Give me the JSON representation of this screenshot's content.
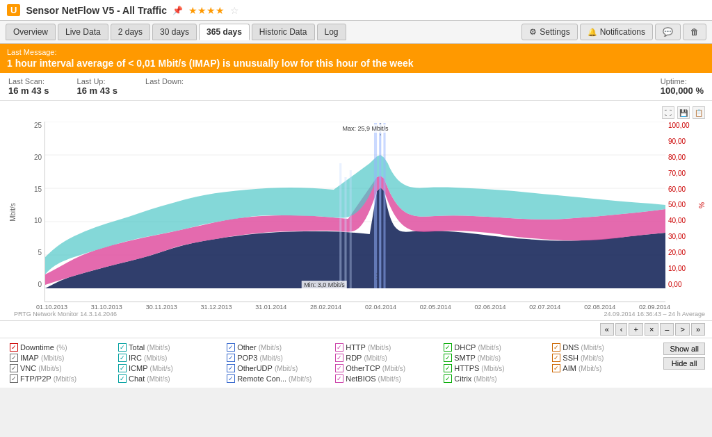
{
  "titleBar": {
    "badge": "U",
    "title": "Sensor NetFlow V5 - All Traffic",
    "stars": "★★★★",
    "halfStar": "☆"
  },
  "tabs": [
    {
      "label": "Overview",
      "active": false
    },
    {
      "label": "Live Data",
      "active": false
    },
    {
      "label": "2 days",
      "active": false
    },
    {
      "label": "30 days",
      "active": false
    },
    {
      "label": "365 days",
      "active": true
    },
    {
      "label": "Historic Data",
      "active": false
    },
    {
      "label": "Log",
      "active": false
    }
  ],
  "navButtons": [
    {
      "label": "Settings",
      "icon": "gear"
    },
    {
      "label": "Notifications",
      "icon": "bell"
    }
  ],
  "alert": {
    "label": "Last Message:",
    "message": "1 hour interval average of < 0,01 Mbit/s (IMAP) is unusually low for this hour of the week"
  },
  "stats": {
    "lastScan": {
      "label": "Last Scan:",
      "value": "16 m 43 s"
    },
    "lastUp": {
      "label": "Last Up:",
      "value": "16 m 43 s"
    },
    "lastDown": {
      "label": "Last Down:",
      "value": ""
    },
    "uptime": {
      "label": "Uptime:",
      "value": "100,000 %"
    }
  },
  "chart": {
    "yAxisLeft": [
      "25",
      "20",
      "15",
      "10",
      "5",
      "0"
    ],
    "yAxisLeftLabel": "Mbit/s",
    "yAxisRight": [
      "100,00",
      "90,00",
      "80,00",
      "70,00",
      "60,00",
      "50,00",
      "40,00",
      "30,00",
      "20,00",
      "10,00",
      "0,00"
    ],
    "yAxisRightLabel": "%",
    "xAxisLabels": [
      "01.10.2013",
      "31.10.2013",
      "30.11.2013",
      "31.12.2013",
      "31.01.2014",
      "28.02.2014",
      "02.04.2014",
      "02.05.2014",
      "02.06.2014",
      "02.07.2014",
      "02.08.2014",
      "02.09.2014"
    ],
    "maxAnnotation": "Max: 25,9 Mbit/s",
    "minAnnotation": "Min: 3,0 Mbit/s",
    "footerLeft": "PRTG Network Monitor 14.3.14.2046",
    "footerRight": "24.09.2014 16:36:43 – 24 h Average"
  },
  "pagination": {
    "buttons": [
      "«",
      "‹",
      "+",
      "×",
      "–",
      ">",
      "»"
    ]
  },
  "legend": [
    {
      "checked": true,
      "color": "red",
      "label": "Downtime",
      "unit": "(%)"
    },
    {
      "checked": true,
      "color": "teal",
      "label": "Total",
      "unit": "(Mbit/s)"
    },
    {
      "checked": true,
      "color": "blue",
      "label": "Other",
      "unit": "(Mbit/s)"
    },
    {
      "checked": true,
      "color": "pink",
      "label": "HTTP",
      "unit": "(Mbit/s)"
    },
    {
      "checked": true,
      "color": "green",
      "label": "DHCP",
      "unit": "(Mbit/s)"
    },
    {
      "checked": true,
      "color": "orange",
      "label": "DNS",
      "unit": "(Mbit/s)"
    },
    {
      "checked": true,
      "color": "gray",
      "label": "IMAP",
      "unit": "(Mbit/s)"
    },
    {
      "checked": true,
      "color": "teal",
      "label": "IRC",
      "unit": "(Mbit/s)"
    },
    {
      "checked": true,
      "color": "blue",
      "label": "POP3",
      "unit": "(Mbit/s)"
    },
    {
      "checked": true,
      "color": "pink",
      "label": "RDP",
      "unit": "(Mbit/s)"
    },
    {
      "checked": true,
      "color": "green",
      "label": "SMTP",
      "unit": "(Mbit/s)"
    },
    {
      "checked": true,
      "color": "orange",
      "label": "SSH",
      "unit": "(Mbit/s)"
    },
    {
      "checked": true,
      "color": "gray",
      "label": "VNC",
      "unit": "(Mbit/s)"
    },
    {
      "checked": true,
      "color": "teal",
      "label": "ICMP",
      "unit": "(Mbit/s)"
    },
    {
      "checked": true,
      "color": "blue",
      "label": "OtherUDP",
      "unit": "(Mbit/s)"
    },
    {
      "checked": true,
      "color": "pink",
      "label": "OtherTCP",
      "unit": "(Mbit/s)"
    },
    {
      "checked": true,
      "color": "green",
      "label": "HTTPS",
      "unit": "(Mbit/s)"
    },
    {
      "checked": true,
      "color": "orange",
      "label": "AIM",
      "unit": "(Mbit/s)"
    },
    {
      "checked": true,
      "color": "gray",
      "label": "FTP/P2P",
      "unit": "(Mbit/s)"
    },
    {
      "checked": true,
      "color": "teal",
      "label": "Chat",
      "unit": "(Mbit/s)"
    },
    {
      "checked": true,
      "color": "blue",
      "label": "Remote Con...",
      "unit": "(Mbit/s)"
    },
    {
      "checked": true,
      "color": "pink",
      "label": "NetBIOS",
      "unit": "(Mbit/s)"
    },
    {
      "checked": true,
      "color": "green",
      "label": "Citrix",
      "unit": "(Mbit/s)"
    }
  ],
  "legendButtons": {
    "showAll": "Show all",
    "hideAll": "Hide all"
  }
}
